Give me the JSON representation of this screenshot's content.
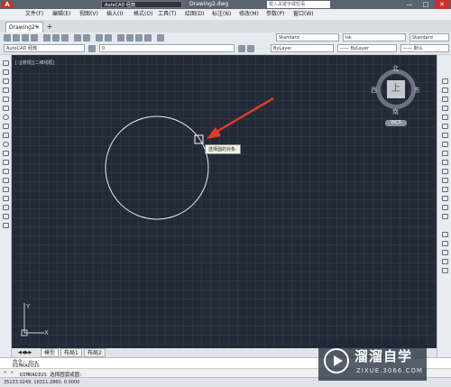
{
  "title_bar": {
    "logo": "A",
    "workspace": "AutoCAD 经典",
    "document": "Drawing2.dwg",
    "search_placeholder": "键入关键字或短语",
    "minimize": "—",
    "maximize": "□",
    "close": "✕"
  },
  "menu": [
    "文件(F)",
    "编辑(E)",
    "视图(V)",
    "插入(I)",
    "格式(O)",
    "工具(T)",
    "绘图(D)",
    "标注(N)",
    "修改(M)",
    "参数(P)",
    "窗口(W)"
  ],
  "doc_tab": {
    "label": "Drawing2*",
    "close": "×",
    "new_tab": "+"
  },
  "toolbar": {
    "text_style": "Standard",
    "dim_style": "lsk",
    "table_style": "Standard",
    "workspace_select": "AutoCAD 经典",
    "layer": "0",
    "color": "ByLayer",
    "linetype": "—— ByLayer",
    "lineweight": "—— 默认"
  },
  "viewport": {
    "label": "[-][俯视][二维线框]",
    "cube_top": "上",
    "north": "北",
    "south": "南",
    "east": "东",
    "west": "西",
    "wcs": "WCS"
  },
  "tooltip": "选择圆的对象:",
  "layout_tabs": [
    "模型",
    "布局1",
    "布局2"
  ],
  "command": {
    "history": [
      "命令: dra",
      "DIMRADIUS"
    ],
    "input": "DIMRADIUS 选择圆弧或圆:"
  },
  "status": {
    "coords": "35133.0249, 18311.2860, 0.0000"
  },
  "watermark": {
    "name": "溜溜自学",
    "url": "ZIXUE.3066.COM"
  },
  "colors": {
    "canvas": "#232a36",
    "arrow": "#e03a2a"
  }
}
